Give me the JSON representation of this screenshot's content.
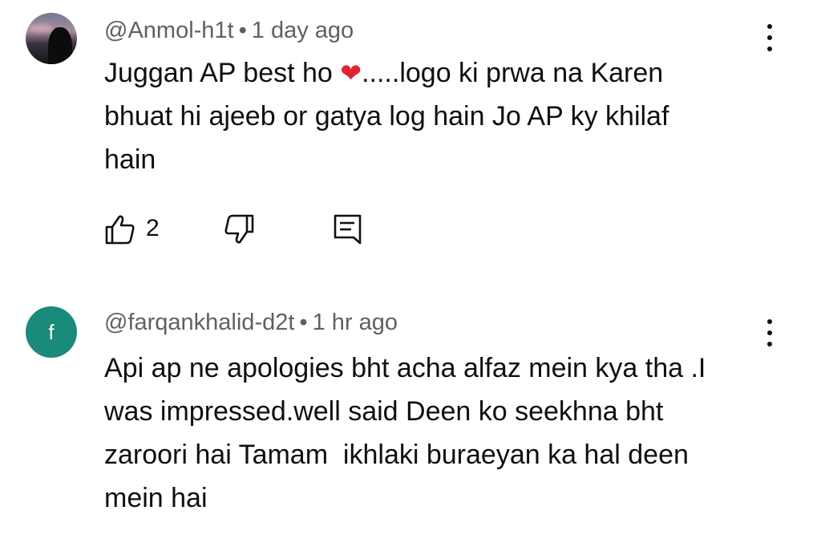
{
  "comments": [
    {
      "handle": "@Anmol-h1t",
      "separator": "•",
      "time": "1 day ago",
      "text_before_emoji": "Juggan AP best ho ",
      "emoji": "❤",
      "text_after_emoji": ".....logo ki prwa na Karen\nbhuat hi ajeeb or gatya log hain Jo AP ky khilaf\nhain",
      "like_count": "2",
      "avatar_icon": "profile-photo"
    },
    {
      "handle": "@farqankhalid-d2t",
      "separator": "•",
      "time": "1 hr ago",
      "text": "Api ap ne apologies bht acha alfaz mein kya tha .I\nwas impressed.well said Deen ko seekhna bht\nzaroori hai Tamam  ikhlaki buraeyan ka hal deen\nmein hai",
      "avatar_letter": "f",
      "avatar_color": "#1a8a7a"
    }
  ],
  "icons": {
    "like": "thumbs-up-icon",
    "dislike": "thumbs-down-icon",
    "reply": "reply-icon",
    "more": "more-vert-icon"
  }
}
